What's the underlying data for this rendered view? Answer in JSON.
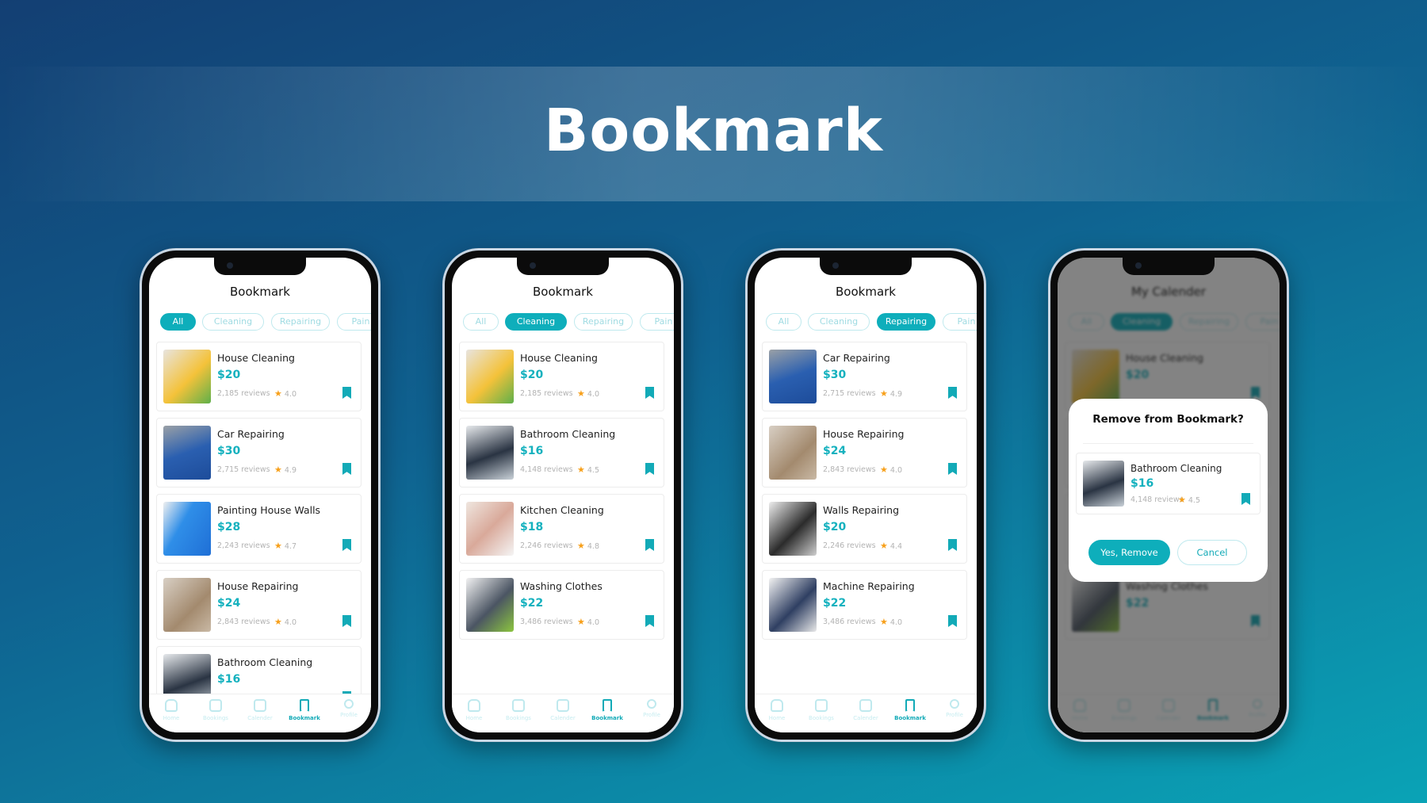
{
  "headline": "Bookmark",
  "colors": {
    "accent": "#0eaebb",
    "star": "#f7a01b",
    "background_start": "#133f73",
    "background_end": "#0aa3b6"
  },
  "tabs": [
    "Home",
    "Bookings",
    "Calender",
    "Bookmark",
    "Profile"
  ],
  "screens": [
    {
      "title": "Bookmark",
      "chips": [
        "All",
        "Cleaning",
        "Repairing",
        "Pain"
      ],
      "active_chip": 0,
      "items": [
        {
          "name": "House Cleaning",
          "price": "$20",
          "reviews": "2,185 reviews",
          "rating": "4.0",
          "image": "woman-cleaning"
        },
        {
          "name": "Car Repairing",
          "price": "$30",
          "reviews": "2,715 reviews",
          "rating": "4.9",
          "image": "mechanic"
        },
        {
          "name": "Painting House Walls",
          "price": "$28",
          "reviews": "2,243 reviews",
          "rating": "4.7",
          "image": "painter-blue-wall"
        },
        {
          "name": "House Repairing",
          "price": "$24",
          "reviews": "2,843 reviews",
          "rating": "4.0",
          "image": "house-renovation"
        },
        {
          "name": "Bathroom Cleaning",
          "price": "$16",
          "reviews": "",
          "rating": "",
          "image": "man-cleaning-floor"
        }
      ]
    },
    {
      "title": "Bookmark",
      "chips": [
        "All",
        "Cleaning",
        "Repairing",
        "Pain"
      ],
      "active_chip": 1,
      "items": [
        {
          "name": "House Cleaning",
          "price": "$20",
          "reviews": "2,185 reviews",
          "rating": "4.0",
          "image": "woman-cleaning"
        },
        {
          "name": "Bathroom Cleaning",
          "price": "$16",
          "reviews": "4,148 reviews",
          "rating": "4.5",
          "image": "man-cleaning-floor"
        },
        {
          "name": "Kitchen Cleaning",
          "price": "$18",
          "reviews": "2,246 reviews",
          "rating": "4.8",
          "image": "kitchen"
        },
        {
          "name": "Washing Clothes",
          "price": "$22",
          "reviews": "3,486 reviews",
          "rating": "4.0",
          "image": "laundry"
        }
      ]
    },
    {
      "title": "Bookmark",
      "chips": [
        "All",
        "Cleaning",
        "Repairing",
        "Pain"
      ],
      "active_chip": 2,
      "items": [
        {
          "name": "Car Repairing",
          "price": "$30",
          "reviews": "2,715 reviews",
          "rating": "4.9",
          "image": "mechanic"
        },
        {
          "name": "House Repairing",
          "price": "$24",
          "reviews": "2,843 reviews",
          "rating": "4.0",
          "image": "house-renovation"
        },
        {
          "name": "Walls Repairing",
          "price": "$20",
          "reviews": "2,246 reviews",
          "rating": "4.4",
          "image": "wall-repair"
        },
        {
          "name": "Machine Repairing",
          "price": "$22",
          "reviews": "3,486 reviews",
          "rating": "4.0",
          "image": "washing-machine-repair"
        }
      ]
    },
    {
      "title": "My Calender",
      "chips": [
        "All",
        "Cleaning",
        "Repairing",
        "Pain"
      ],
      "active_chip": 1,
      "items": [
        {
          "name": "House Cleaning",
          "price": "$20",
          "reviews": "",
          "rating": "",
          "image": "woman-cleaning"
        },
        {
          "name": "",
          "price": "",
          "reviews": "",
          "rating": "",
          "image": "hidden"
        },
        {
          "name": "",
          "price": "",
          "reviews": "",
          "rating": "",
          "image": "hidden"
        },
        {
          "name": "Washing Clothes",
          "price": "$22",
          "reviews": "",
          "rating": "",
          "image": "laundry"
        }
      ],
      "modal": {
        "title": "Remove from Bookmark?",
        "item": {
          "name": "Bathroom Cleaning",
          "price": "$16",
          "reviews": "4,148 reviews",
          "rating": "4.5",
          "image": "man-cleaning-floor"
        },
        "confirm": "Yes, Remove",
        "cancel": "Cancel"
      }
    }
  ]
}
